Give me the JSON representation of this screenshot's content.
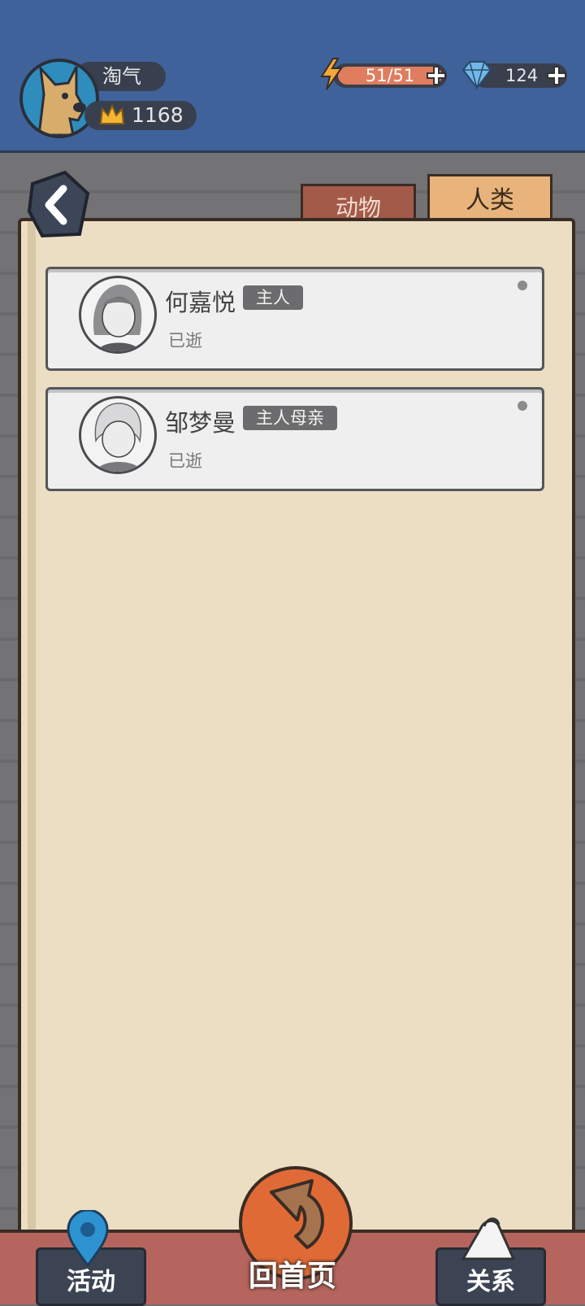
{
  "player": {
    "name": "淘气",
    "crowns": "1168"
  },
  "resources": {
    "energy": "51/51",
    "energy_fraction": 1.0,
    "gems": "124"
  },
  "tabs": [
    {
      "label": "动物",
      "selected": false
    },
    {
      "label": "人类",
      "selected": true
    }
  ],
  "people": [
    {
      "name": "何嘉悦",
      "tag": "主人",
      "status": "已逝"
    },
    {
      "name": "邹梦曼",
      "tag": "主人母亲",
      "status": "已逝"
    }
  ],
  "nav": {
    "activity": "活动",
    "home": "回首页",
    "relations": "关系"
  },
  "colors": {
    "header": "#40629a",
    "paper": "#ecdec3",
    "energy": "#e07d5e",
    "home": "#e06a36"
  }
}
